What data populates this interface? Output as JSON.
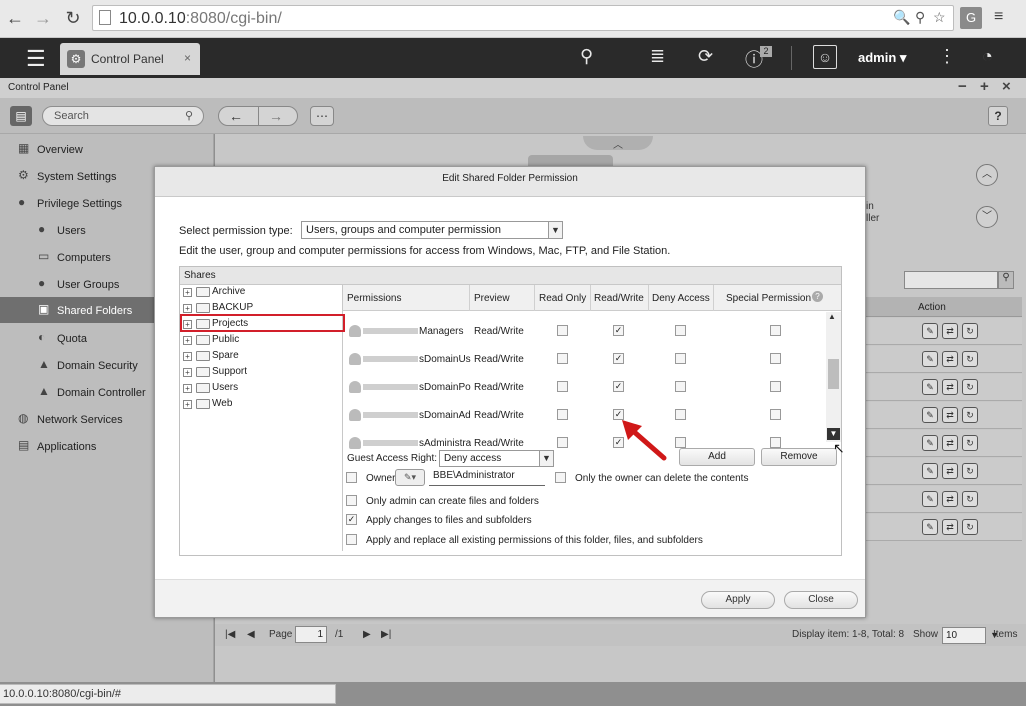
{
  "browser": {
    "url_host": "10.0.0.10",
    "url_rest": ":8080/cgi-bin/",
    "extension_label": "G"
  },
  "app": {
    "tab_label": "Control Panel",
    "user_label": "admin",
    "notification_count": "2"
  },
  "cp": {
    "window_title": "Control Panel",
    "search_placeholder": "Search",
    "help_label": "?"
  },
  "sidebar": {
    "items": [
      {
        "label": "Overview",
        "icon": "overview-icon"
      },
      {
        "label": "System Settings",
        "icon": "gear-icon"
      },
      {
        "label": "Privilege Settings",
        "icon": "user-icon"
      },
      {
        "label": "Users",
        "icon": "user-icon"
      },
      {
        "label": "Computers",
        "icon": "computer-icon"
      },
      {
        "label": "User Groups",
        "icon": "users-icon"
      },
      {
        "label": "Shared Folders",
        "icon": "shared-folder-icon"
      },
      {
        "label": "Quota",
        "icon": "quota-icon"
      },
      {
        "label": "Domain Security",
        "icon": "domain-icon"
      },
      {
        "label": "Domain Controller",
        "icon": "domain-controller-icon"
      },
      {
        "label": "Network Services",
        "icon": "globe-icon"
      },
      {
        "label": "Applications",
        "icon": "applications-icon"
      }
    ],
    "selected": "Shared Folders"
  },
  "main": {
    "fragment_line1": "in",
    "fragment_line2": "ller",
    "action_header": "Action"
  },
  "pager": {
    "page_label": "Page",
    "page_value": "1",
    "page_total": "/1",
    "display_info": "Display item: 1-8, Total: 8",
    "show_label": "Show",
    "show_value": "10",
    "items_label": "Items"
  },
  "status_url": "10.0.0.10:8080/cgi-bin/#",
  "dialog": {
    "title": "Edit Shared Folder Permission",
    "perm_type_label": "Select permission type:",
    "perm_type_value": "Users, groups and computer permission",
    "description": "Edit the user, group and computer permissions for access from Windows, Mac, FTP, and File Station.",
    "shares_header": "Shares",
    "tree": [
      "Archive",
      "BACKUP",
      "Projects",
      "Public",
      "Spare",
      "Support",
      "Users",
      "Web"
    ],
    "selected_share": "Projects",
    "columns": [
      "Permissions",
      "Preview",
      "Read Only",
      "Read/Write",
      "Deny Access",
      "Special Permission"
    ],
    "rows": [
      {
        "name": "Managers",
        "preview": "Read/Write",
        "read_only": false,
        "read_write": true,
        "deny": false,
        "special": false
      },
      {
        "name": "sDomainUs",
        "preview": "Read/Write",
        "read_only": false,
        "read_write": true,
        "deny": false,
        "special": false
      },
      {
        "name": "sDomainPo",
        "preview": "Read/Write",
        "read_only": false,
        "read_write": true,
        "deny": false,
        "special": false
      },
      {
        "name": "sDomainAd",
        "preview": "Read/Write",
        "read_only": false,
        "read_write": true,
        "deny": false,
        "special": false
      },
      {
        "name": "sAdministra",
        "preview": "Read/Write",
        "read_only": false,
        "read_write": true,
        "deny": false,
        "special": false
      }
    ],
    "guest_label": "Guest Access Right:",
    "guest_value": "Deny access",
    "add_label": "Add",
    "remove_label": "Remove",
    "owner_label": "Owner:",
    "owner_value": "BBE\\Administrator",
    "owner_only_delete": "Only the owner can delete the contents",
    "only_admin_create": "Only admin can create files and folders",
    "apply_changes": "Apply changes to files and subfolders",
    "apply_replace": "Apply and replace all existing permissions of this folder, files, and subfolders",
    "apply_label": "Apply",
    "close_label": "Close",
    "options": {
      "owner_checked": false,
      "owner_only_delete_checked": false,
      "only_admin_create_checked": false,
      "apply_changes_checked": true,
      "apply_replace_checked": false
    }
  }
}
